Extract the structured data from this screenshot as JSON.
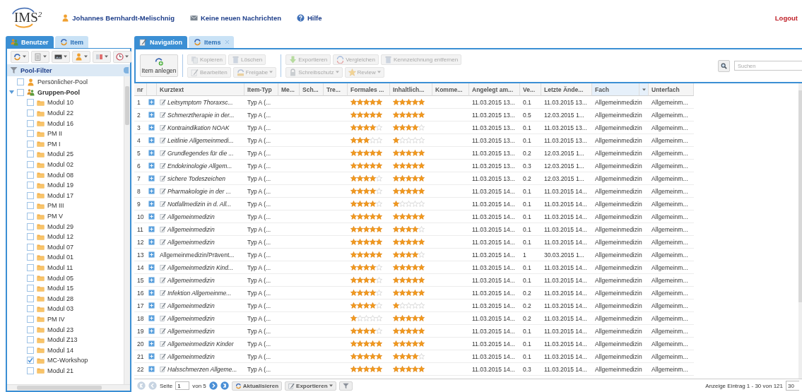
{
  "header": {
    "logo": "IMS$^{2}$",
    "user": "Johannes Bernhardt-Melischnig",
    "messages": "Keine neuen Nachrichten",
    "help": "Hilfe",
    "logout": "Logout"
  },
  "left_panel": {
    "tabs": [
      {
        "label": "Benutzer",
        "selected": true
      },
      {
        "label": "Item",
        "selected": false
      }
    ],
    "pool_filter": "Pool-Filter",
    "tree": [
      {
        "label": "Persönlicher-Pool",
        "kind": "user",
        "checked": false
      },
      {
        "label": "Gruppen-Pool",
        "kind": "group",
        "checked": false,
        "expanded": true,
        "children": [
          {
            "label": "Modul 10",
            "checked": false
          },
          {
            "label": "Modul 22",
            "checked": false
          },
          {
            "label": "Modul 16",
            "checked": false
          },
          {
            "label": "PM II",
            "checked": false
          },
          {
            "label": "PM I",
            "checked": false
          },
          {
            "label": "Modul 25",
            "checked": false
          },
          {
            "label": "Modul 02",
            "checked": false
          },
          {
            "label": "Modul 08",
            "checked": false
          },
          {
            "label": "Modul 19",
            "checked": false
          },
          {
            "label": "Modul 17",
            "checked": false
          },
          {
            "label": "PM III",
            "checked": false
          },
          {
            "label": "PM V",
            "checked": false
          },
          {
            "label": "Modul 29",
            "checked": false
          },
          {
            "label": "Modul 12",
            "checked": false
          },
          {
            "label": "Modul 07",
            "checked": false
          },
          {
            "label": "Modul 01",
            "checked": false
          },
          {
            "label": "Modul 11",
            "checked": false
          },
          {
            "label": "Modul 05",
            "checked": false
          },
          {
            "label": "Modul 15",
            "checked": false
          },
          {
            "label": "Modul 28",
            "checked": false
          },
          {
            "label": "Modul 03",
            "checked": false
          },
          {
            "label": "PM IV",
            "checked": false
          },
          {
            "label": "Modul 23",
            "checked": false
          },
          {
            "label": "Modul Z13",
            "checked": false
          },
          {
            "label": "Modul 14",
            "checked": false
          },
          {
            "label": "MC-Workshop",
            "checked": true
          },
          {
            "label": "Modul 21",
            "checked": false
          }
        ]
      }
    ]
  },
  "main_panel": {
    "tabs": [
      {
        "label": "Navigation",
        "selected": true
      },
      {
        "label": "Items",
        "selected": false
      }
    ],
    "toolbar": {
      "create_button": "Item anlegen",
      "groups": [
        [
          [
            {
              "label": "Kopieren",
              "disabled": true,
              "dropdown": false
            },
            {
              "label": "Löschen",
              "disabled": true,
              "dropdown": false
            }
          ],
          [
            {
              "label": "Bearbeiten",
              "disabled": true,
              "dropdown": false
            },
            {
              "label": "Freigabe",
              "disabled": true,
              "dropdown": true
            }
          ]
        ],
        [
          [
            {
              "label": "Exportieren",
              "disabled": true,
              "dropdown": false
            },
            {
              "label": "Vergleichen",
              "disabled": true,
              "dropdown": false
            },
            {
              "label": "Kennzeichnung entfernen",
              "disabled": true,
              "dropdown": false
            }
          ],
          [
            {
              "label": "Schreibschutz",
              "disabled": true,
              "dropdown": true
            },
            {
              "label": "Review",
              "disabled": true,
              "dropdown": true
            }
          ]
        ]
      ]
    },
    "search": {
      "placeholder": "Suchen"
    },
    "table": {
      "columns": [
        {
          "label": "nr",
          "highlighted": false
        },
        {
          "highlighted": false
        },
        {
          "label": "Kurztext",
          "highlighted": false
        },
        {
          "label": "Item-Typ",
          "highlighted": false
        },
        {
          "label": "Me...",
          "highlighted": false
        },
        {
          "label": "Sch...",
          "highlighted": false
        },
        {
          "label": "Tre...",
          "highlighted": false
        },
        {
          "label": "Formales ...",
          "highlighted": false
        },
        {
          "label": "Inhaltlich...",
          "highlighted": false
        },
        {
          "label": "Komme...",
          "highlighted": false
        },
        {
          "label": "Angelegt am...",
          "highlighted": false
        },
        {
          "label": "Ve...",
          "highlighted": false
        },
        {
          "label": "Letzte Ände...",
          "highlighted": false
        },
        {
          "label": "Fach",
          "highlighted": true
        },
        {
          "label": "Unterfach",
          "highlighted": false
        }
      ],
      "rows": [
        {
          "nr": "1",
          "text": "Leitsymptom Thoraxsc...",
          "editable": true,
          "type": "Typ A (...",
          "formal": {
            "stars": 5
          },
          "content": {
            "stars": 5
          },
          "created": "11.03.2015 13...",
          "version": "0.1",
          "changed": "11.03.2015 13...",
          "subject": "Allgemeinmedizin",
          "subsubject": "Allgemeinm..."
        },
        {
          "nr": "2",
          "text": "Schmerztherapie in der...",
          "editable": true,
          "type": "Typ A (...",
          "formal": {
            "stars": 5
          },
          "content": {
            "stars": 5
          },
          "created": "11.03.2015 13...",
          "version": "0.5",
          "changed": "12.03.2015 1...",
          "subject": "Allgemeinmedizin",
          "subsubject": "Allgemeinm..."
        },
        {
          "nr": "3",
          "text": "Kontraindikation NOAK",
          "editable": true,
          "type": "Typ A (...",
          "formal": {
            "stars": 4
          },
          "content": {
            "stars": 4
          },
          "created": "11.03.2015 13...",
          "version": "0.1",
          "changed": "11.03.2015 13...",
          "subject": "Allgemeinmedizin",
          "subsubject": "Allgemeinm..."
        },
        {
          "nr": "4",
          "text": "Leitlinie Allgemeinmedi...",
          "editable": true,
          "type": "Typ A (...",
          "formal": {
            "stars": 3
          },
          "content": {
            "stars": 1
          },
          "created": "11.03.2015 13...",
          "version": "0.1",
          "changed": "11.03.2015 13...",
          "subject": "Allgemeinmedizin",
          "subsubject": "Allgemeinm..."
        },
        {
          "nr": "5",
          "text": "Grundlegendes für die ...",
          "editable": true,
          "type": "Typ A (...",
          "formal": {
            "stars": 5
          },
          "content": {
            "stars": 5
          },
          "created": "11.03.2015 13...",
          "version": "0.2",
          "changed": "12.03.2015 1...",
          "subject": "Allgemeinmedizin",
          "subsubject": "Allgemeinm..."
        },
        {
          "nr": "6",
          "text": "Endokrinologie Allgem...",
          "editable": true,
          "type": "Typ A (...",
          "formal": {
            "stars": 5
          },
          "content": {
            "stars": 5
          },
          "created": "11.03.2015 13...",
          "version": "0.3",
          "changed": "12.03.2015 1...",
          "subject": "Allgemeinmedizin",
          "subsubject": "Allgemeinm..."
        },
        {
          "nr": "7",
          "text": "sichere Todeszeichen",
          "editable": true,
          "type": "Typ A (...",
          "formal": {
            "stars": 4
          },
          "content": {
            "stars": 5
          },
          "created": "11.03.2015 13...",
          "version": "0.2",
          "changed": "12.03.2015 1...",
          "subject": "Allgemeinmedizin",
          "subsubject": "Allgemeinm..."
        },
        {
          "nr": "8",
          "text": "Pharmakologie in der ...",
          "editable": true,
          "type": "Typ A (...",
          "formal": {
            "stars": 4
          },
          "content": {
            "stars": 5
          },
          "created": "11.03.2015 14...",
          "version": "0.1",
          "changed": "11.03.2015 14...",
          "subject": "Allgemeinmedizin",
          "subsubject": "Allgemeinm..."
        },
        {
          "nr": "9",
          "text": "Notfallmedizin in d. All...",
          "editable": true,
          "type": "Typ A (...",
          "formal": {
            "stars": 4
          },
          "content": {
            "stars": 1
          },
          "created": "11.03.2015 14...",
          "version": "0.1",
          "changed": "11.03.2015 14...",
          "subject": "Allgemeinmedizin",
          "subsubject": "Allgemeinm..."
        },
        {
          "nr": "10",
          "text": "Allgemeinmedizin",
          "editable": true,
          "type": "Typ A (...",
          "formal": {
            "stars": 5
          },
          "content": {
            "stars": 5
          },
          "created": "11.03.2015 14...",
          "version": "0.1",
          "changed": "11.03.2015 14...",
          "subject": "Allgemeinmedizin",
          "subsubject": "Allgemeinm..."
        },
        {
          "nr": "11",
          "text": "Allgemeinmedizin",
          "editable": true,
          "type": "Typ A (...",
          "formal": {
            "stars": 5
          },
          "content": {
            "stars": 4
          },
          "created": "11.03.2015 14...",
          "version": "0.1",
          "changed": "11.03.2015 14...",
          "subject": "Allgemeinmedizin",
          "subsubject": "Allgemeinm..."
        },
        {
          "nr": "12",
          "text": "Allgemeinmedizin",
          "editable": true,
          "type": "Typ A (...",
          "formal": {
            "stars": 5
          },
          "content": {
            "stars": 5
          },
          "created": "11.03.2015 14...",
          "version": "0.1",
          "changed": "11.03.2015 14...",
          "subject": "Allgemeinmedizin",
          "subsubject": "Allgemeinm..."
        },
        {
          "nr": "13",
          "text": "Allgemeinmedizin/Prävent...",
          "editable": false,
          "type": "Typ A (...",
          "formal": {
            "stars": 5
          },
          "content": {
            "stars": 4
          },
          "created": "11.03.2015 14...",
          "version": "1",
          "changed": "30.03.2015 1...",
          "subject": "Allgemeinmedizin",
          "subsubject": "Allgemeinm..."
        },
        {
          "nr": "14",
          "text": "Allgemeinmedizin Kind...",
          "editable": true,
          "type": "Typ A (...",
          "formal": {
            "stars": 4
          },
          "content": {
            "stars": 5
          },
          "created": "11.03.2015 14...",
          "version": "0.1",
          "changed": "11.03.2015 14...",
          "subject": "Allgemeinmedizin",
          "subsubject": "Allgemeinm..."
        },
        {
          "nr": "15",
          "text": "Allgemeinmedizin",
          "editable": true,
          "type": "Typ A (...",
          "formal": {
            "stars": 4
          },
          "content": {
            "stars": 5
          },
          "created": "11.03.2015 14...",
          "version": "0.1",
          "changed": "11.03.2015 14...",
          "subject": "Allgemeinmedizin",
          "subsubject": "Allgemeinm..."
        },
        {
          "nr": "16",
          "text": "Infektion Allgemeinme...",
          "editable": true,
          "type": "Typ A (...",
          "formal": {
            "stars": 4
          },
          "content": {
            "stars": 5
          },
          "created": "11.03.2015 14...",
          "version": "0.2",
          "changed": "11.03.2015 14...",
          "subject": "Allgemeinmedizin",
          "subsubject": "Allgemeinm..."
        },
        {
          "nr": "17",
          "text": "Allgemeinmedizin",
          "editable": true,
          "type": "Typ A (...",
          "formal": {
            "stars": 4
          },
          "content": {
            "stars": 1
          },
          "created": "11.03.2015 14...",
          "version": "0.2",
          "changed": "11.03.2015 14...",
          "subject": "Allgemeinmedizin",
          "subsubject": "Allgemeinm..."
        },
        {
          "nr": "18",
          "text": "Allgemeinmedizin",
          "editable": true,
          "type": "Typ A (...",
          "formal": {
            "stars": 1
          },
          "content": {
            "stars": 5
          },
          "created": "11.03.2015 14...",
          "version": "0.2",
          "changed": "11.03.2015 14...",
          "subject": "Allgemeinmedizin",
          "subsubject": "Allgemeinm..."
        },
        {
          "nr": "19",
          "text": "Allgemeinmedizin",
          "editable": true,
          "type": "Typ A (...",
          "formal": {
            "stars": 4
          },
          "content": {
            "stars": 5
          },
          "created": "11.03.2015 14...",
          "version": "0.1",
          "changed": "11.03.2015 14...",
          "subject": "Allgemeinmedizin",
          "subsubject": "Allgemeinm..."
        },
        {
          "nr": "20",
          "text": "Allgemeinmedizin Kinder",
          "editable": true,
          "type": "Typ A (...",
          "formal": {
            "stars": 5
          },
          "content": {
            "stars": 5
          },
          "created": "11.03.2015 14...",
          "version": "0.1",
          "changed": "11.03.2015 14...",
          "subject": "Allgemeinmedizin",
          "subsubject": "Allgemeinm..."
        },
        {
          "nr": "21",
          "text": "Allgemeinmedizin",
          "editable": true,
          "type": "Typ A (...",
          "formal": {
            "stars": 5
          },
          "content": {
            "stars": 4
          },
          "created": "11.03.2015 14...",
          "version": "0.1",
          "changed": "11.03.2015 14...",
          "subject": "Allgemeinmedizin",
          "subsubject": "Allgemeinm..."
        },
        {
          "nr": "22",
          "text": "Halsschmerzen Allgeme...",
          "editable": true,
          "type": "Typ A (...",
          "formal": {
            "stars": 5
          },
          "content": {
            "stars": 5
          },
          "created": "11.03.2015 14...",
          "version": "0.3",
          "changed": "11.03.2015 14...",
          "subject": "Allgemeinmedizin",
          "subsubject": "Allgemeinm..."
        }
      ]
    },
    "pager": {
      "back_buttons": [
        {
          "kind": "first",
          "disabled": true
        },
        {
          "kind": "prev",
          "disabled": true
        }
      ],
      "page_label": "Seite",
      "page": "1",
      "of": "von 5",
      "forward_buttons": [
        {
          "kind": "next",
          "disabled": false
        },
        {
          "kind": "last",
          "disabled": false
        }
      ],
      "refresh": "Aktualisieren",
      "export": "Exportieren",
      "summary": "Anzeige Eintrag 1 - 30 von 121",
      "page_size": "30"
    }
  }
}
